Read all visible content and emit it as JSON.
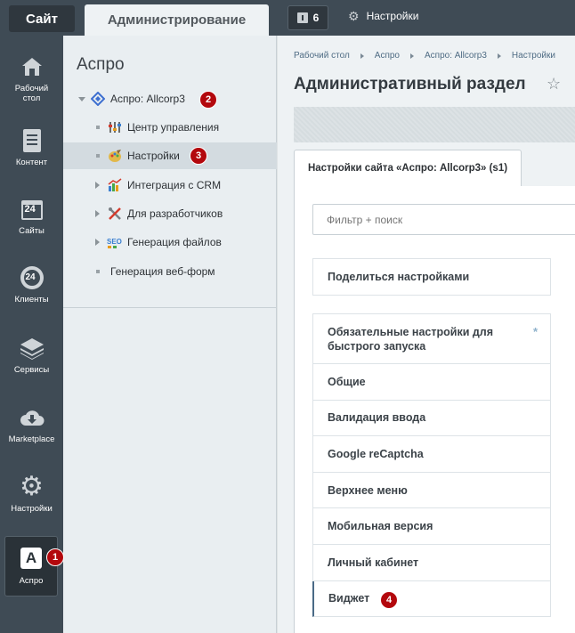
{
  "topbar": {
    "site_tab": "Сайт",
    "admin_tab": "Администрирование",
    "notify_count": "6",
    "settings_label": "Настройки"
  },
  "sidebar": {
    "items": [
      {
        "label_line1": "Рабочий",
        "label_line2": "стол",
        "icon": "home-icon"
      },
      {
        "label_line1": "Контент",
        "label_line2": "",
        "icon": "document-icon"
      },
      {
        "label_line1": "Сайты",
        "label_line2": "",
        "icon": "calendar-icon",
        "number": "24"
      },
      {
        "label_line1": "Клиенты",
        "label_line2": "",
        "icon": "clients-icon",
        "number": "24"
      },
      {
        "label_line1": "Сервисы",
        "label_line2": "",
        "icon": "layers-icon"
      },
      {
        "label_line1": "Marketplace",
        "label_line2": "",
        "icon": "cloud-download-icon"
      },
      {
        "label_line1": "Настройки",
        "label_line2": "",
        "icon": "gear-icon"
      },
      {
        "label_line1": "Аспро",
        "label_line2": "",
        "icon": "aspro-logo-icon",
        "logo_letter": "A"
      }
    ]
  },
  "menu": {
    "title": "Аспро",
    "root": "Аспро: Allcorp3",
    "items": [
      {
        "label": "Центр управления",
        "icon": "sliders-icon"
      },
      {
        "label": "Настройки",
        "icon": "palette-icon"
      },
      {
        "label": "Интеграция с CRM",
        "icon": "chart-icon"
      },
      {
        "label": "Для разработчиков",
        "icon": "tools-icon"
      },
      {
        "label": "Генерация файлов",
        "icon": "seo-icon"
      },
      {
        "label": "Генерация веб-форм",
        "icon": ""
      }
    ]
  },
  "badges": {
    "b1": "1",
    "b2": "2",
    "b3": "3",
    "b4": "4"
  },
  "main": {
    "breadcrumb": [
      "Рабочий стол",
      "Аспро",
      "Аспро: Allcorp3",
      "Настройки"
    ],
    "title": "Административный раздел",
    "tab_label": "Настройки сайта «Аспро: Allcorp3» (s1)",
    "filter_placeholder": "Фильтр + поиск",
    "share_label": "Поделиться настройками",
    "required_line1": "Обязательные настройки для",
    "required_line2": "быстрого запуска",
    "required_mark": "*",
    "list": [
      "Общие",
      "Валидация ввода",
      "Google reCaptcha",
      "Верхнее меню",
      "Мобильная версия",
      "Личный кабинет",
      "Виджет"
    ]
  },
  "colors": {
    "sidebar_bg": "#3f4b55",
    "menu_bg": "#e9eef1",
    "badge_red": "#b3080d",
    "accent_blue": "#4f6c84"
  }
}
